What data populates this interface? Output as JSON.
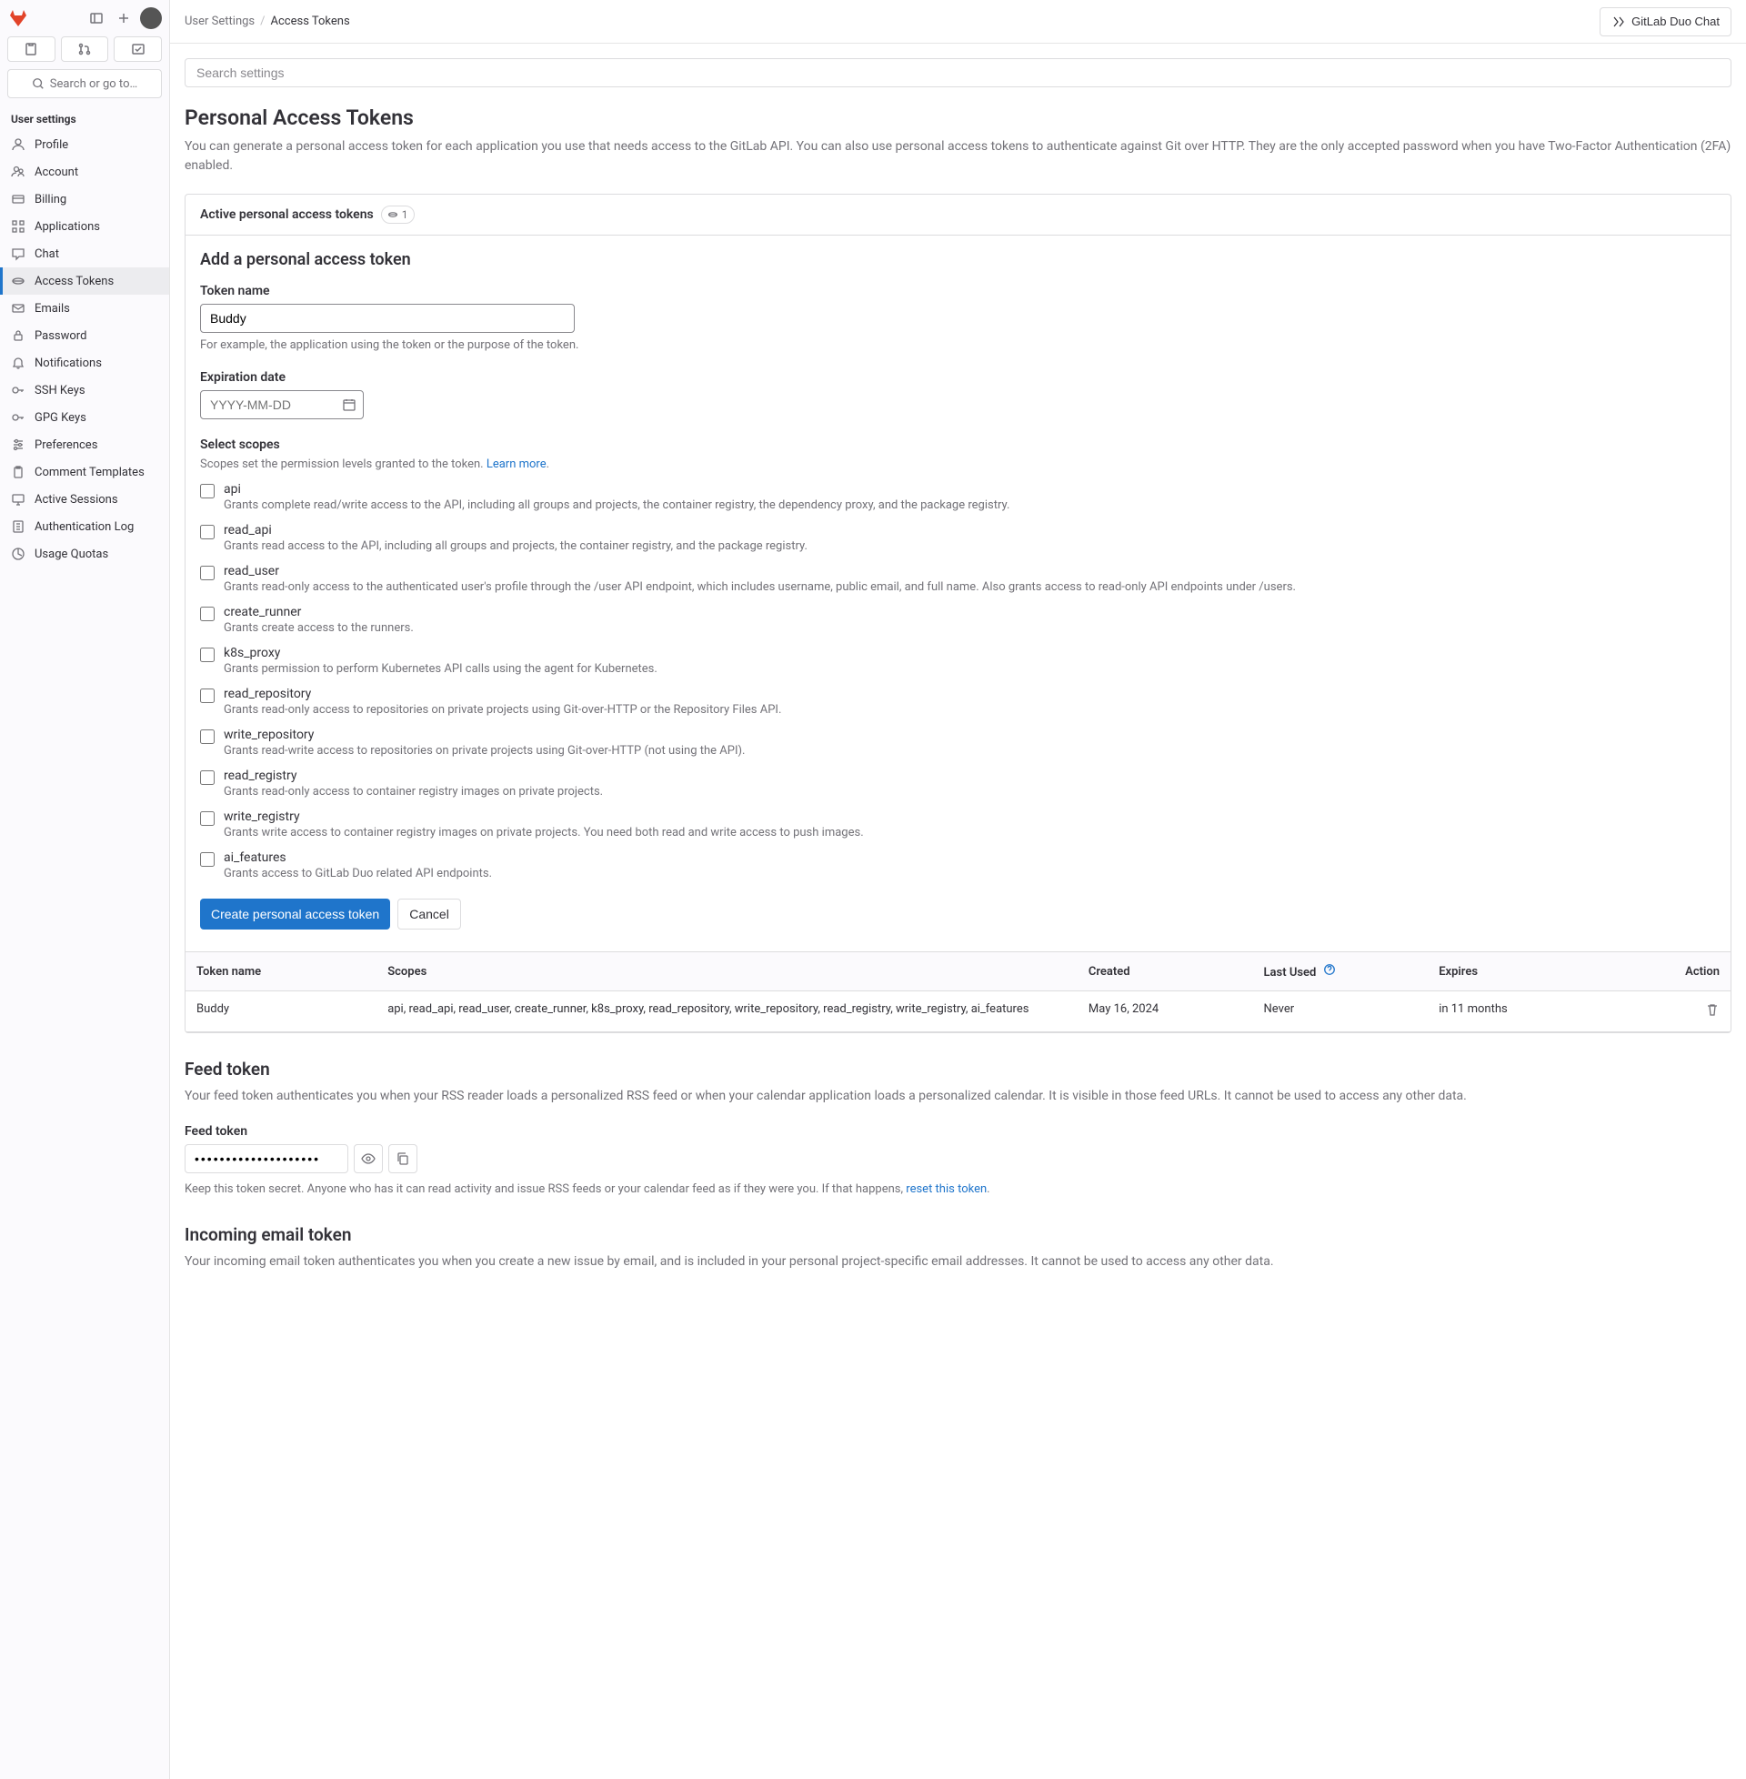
{
  "search_sidebar_placeholder": "Search or go to…",
  "sidebar_section": "User settings",
  "sidebar_items": [
    {
      "label": "Profile",
      "icon": "profile"
    },
    {
      "label": "Account",
      "icon": "account"
    },
    {
      "label": "Billing",
      "icon": "billing"
    },
    {
      "label": "Applications",
      "icon": "apps"
    },
    {
      "label": "Chat",
      "icon": "chat"
    },
    {
      "label": "Access Tokens",
      "icon": "token",
      "active": true
    },
    {
      "label": "Emails",
      "icon": "email"
    },
    {
      "label": "Password",
      "icon": "lock"
    },
    {
      "label": "Notifications",
      "icon": "bell"
    },
    {
      "label": "SSH Keys",
      "icon": "key"
    },
    {
      "label": "GPG Keys",
      "icon": "key"
    },
    {
      "label": "Preferences",
      "icon": "prefs"
    },
    {
      "label": "Comment Templates",
      "icon": "clipboard"
    },
    {
      "label": "Active Sessions",
      "icon": "sessions"
    },
    {
      "label": "Authentication Log",
      "icon": "log"
    },
    {
      "label": "Usage Quotas",
      "icon": "quota"
    }
  ],
  "breadcrumb": {
    "parent": "User Settings",
    "current": "Access Tokens"
  },
  "duo_chat": "GitLab Duo Chat",
  "search_settings_placeholder": "Search settings",
  "page_title": "Personal Access Tokens",
  "page_desc": "You can generate a personal access token for each application you use that needs access to the GitLab API. You can also use personal access tokens to authenticate against Git over HTTP. They are the only accepted password when you have Two-Factor Authentication (2FA) enabled.",
  "active_tokens_label": "Active personal access tokens",
  "active_tokens_count": "1",
  "form": {
    "title": "Add a personal access token",
    "name_label": "Token name",
    "name_value": "Buddy",
    "name_help": "For example, the application using the token or the purpose of the token.",
    "exp_label": "Expiration date",
    "exp_placeholder": "YYYY-MM-DD",
    "scopes_label": "Select scopes",
    "scopes_intro": "Scopes set the permission levels granted to the token. ",
    "learn_more": "Learn more",
    "create_btn": "Create personal access token",
    "cancel_btn": "Cancel"
  },
  "scopes": [
    {
      "name": "api",
      "desc": "Grants complete read/write access to the API, including all groups and projects, the container registry, the dependency proxy, and the package registry."
    },
    {
      "name": "read_api",
      "desc": "Grants read access to the API, including all groups and projects, the container registry, and the package registry."
    },
    {
      "name": "read_user",
      "desc": "Grants read-only access to the authenticated user's profile through the /user API endpoint, which includes username, public email, and full name. Also grants access to read-only API endpoints under /users."
    },
    {
      "name": "create_runner",
      "desc": "Grants create access to the runners."
    },
    {
      "name": "k8s_proxy",
      "desc": "Grants permission to perform Kubernetes API calls using the agent for Kubernetes."
    },
    {
      "name": "read_repository",
      "desc": "Grants read-only access to repositories on private projects using Git-over-HTTP or the Repository Files API."
    },
    {
      "name": "write_repository",
      "desc": "Grants read-write access to repositories on private projects using Git-over-HTTP (not using the API)."
    },
    {
      "name": "read_registry",
      "desc": "Grants read-only access to container registry images on private projects."
    },
    {
      "name": "write_registry",
      "desc": "Grants write access to container registry images on private projects. You need both read and write access to push images."
    },
    {
      "name": "ai_features",
      "desc": "Grants access to GitLab Duo related API endpoints."
    }
  ],
  "table": {
    "headers": {
      "name": "Token name",
      "scopes": "Scopes",
      "created": "Created",
      "last_used": "Last Used",
      "expires": "Expires",
      "action": "Action"
    },
    "rows": [
      {
        "name": "Buddy",
        "scopes": "api, read_api, read_user, create_runner, k8s_proxy, read_repository, write_repository, read_registry, write_registry, ai_features",
        "created": "May 16, 2024",
        "last_used": "Never",
        "expires": "in 11 months"
      }
    ]
  },
  "feed": {
    "title": "Feed token",
    "desc": "Your feed token authenticates you when your RSS reader loads a personalized RSS feed or when your calendar application loads a personalized calendar. It is visible in those feed URLs. It cannot be used to access any other data.",
    "label": "Feed token",
    "value": "••••••••••••••••••••",
    "note_pre": "Keep this token secret. Anyone who has it can read activity and issue RSS feeds or your calendar feed as if they were you. If that happens, ",
    "reset_link": "reset this token",
    "note_post": "."
  },
  "email_token": {
    "title": "Incoming email token",
    "desc": "Your incoming email token authenticates you when you create a new issue by email, and is included in your personal project-specific email addresses. It cannot be used to access any other data."
  }
}
